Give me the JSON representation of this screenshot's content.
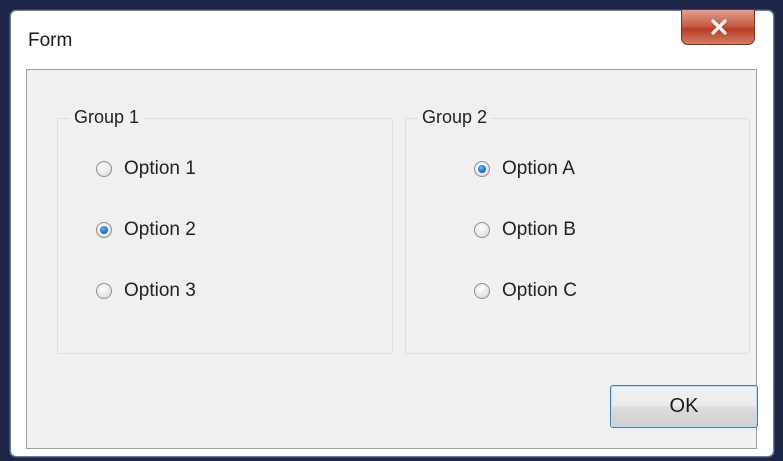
{
  "window": {
    "title": "Form",
    "close_icon": "close-icon"
  },
  "groups": [
    {
      "label": "Group 1",
      "options": [
        {
          "label": "Option 1",
          "checked": false
        },
        {
          "label": "Option 2",
          "checked": true
        },
        {
          "label": "Option 3",
          "checked": false
        }
      ]
    },
    {
      "label": "Group 2",
      "options": [
        {
          "label": "Option A",
          "checked": true
        },
        {
          "label": "Option B",
          "checked": false
        },
        {
          "label": "Option C",
          "checked": false
        }
      ]
    }
  ],
  "buttons": {
    "ok_label": "OK"
  },
  "colors": {
    "close_button": "#c4563e",
    "radio_selected": "#1f6fc4",
    "ok_button_border": "#3c7fb1"
  }
}
